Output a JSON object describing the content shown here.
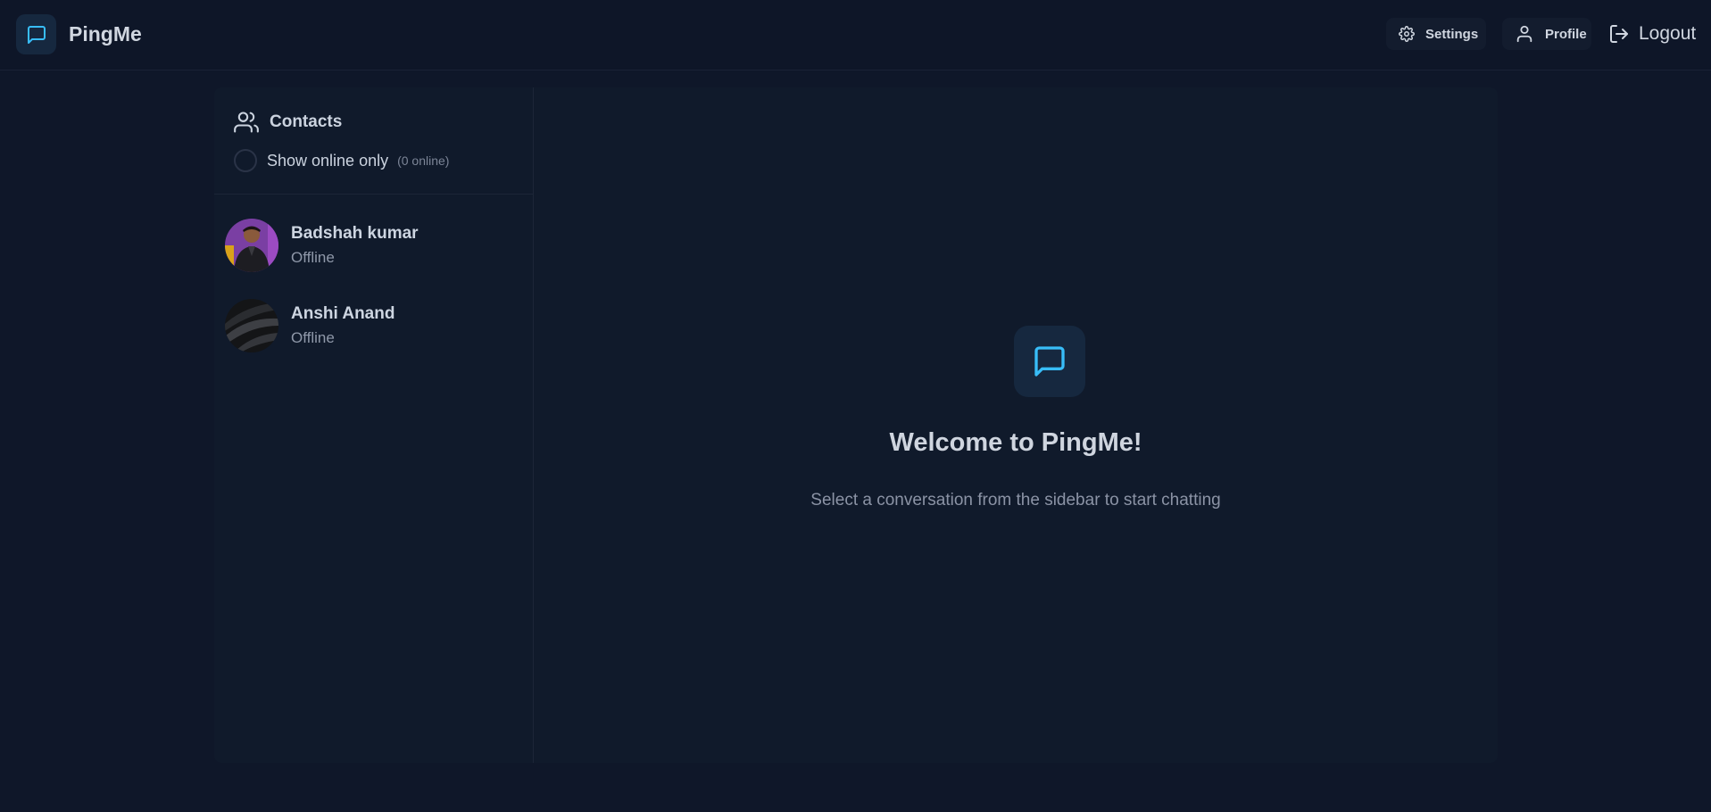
{
  "app": {
    "name": "PingMe"
  },
  "header": {
    "settings_label": "Settings",
    "profile_label": "Profile",
    "logout_label": "Logout"
  },
  "sidebar": {
    "title": "Contacts",
    "filter_label": "Show online only",
    "online_count": "(0 online)",
    "contacts": [
      {
        "name": "Badshah kumar",
        "status": "Offline"
      },
      {
        "name": "Anshi Anand",
        "status": "Offline"
      }
    ]
  },
  "welcome": {
    "title": "Welcome to PingMe!",
    "subtitle": "Select a conversation from the sidebar to start chatting"
  },
  "colors": {
    "background": "#0f1729",
    "accent": "#38bdf8",
    "icon_bg": "#16283f"
  }
}
